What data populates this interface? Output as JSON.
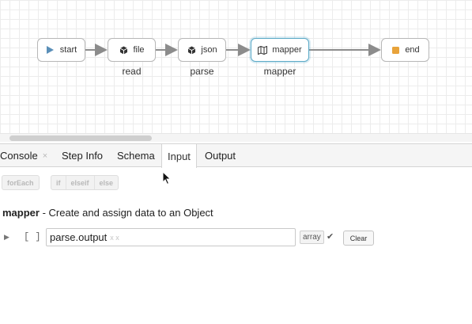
{
  "flow": {
    "nodes": [
      {
        "id": "start",
        "label": "start",
        "icon": "play-icon",
        "sublabel": ""
      },
      {
        "id": "file",
        "label": "file",
        "icon": "cube-icon",
        "sublabel": "read"
      },
      {
        "id": "json",
        "label": "json",
        "icon": "cube-icon",
        "sublabel": "parse"
      },
      {
        "id": "mapper",
        "label": "mapper",
        "icon": "map-icon",
        "sublabel": "mapper",
        "selected": true
      },
      {
        "id": "end",
        "label": "end",
        "icon": "stop-icon",
        "sublabel": ""
      }
    ],
    "colors": {
      "start_icon": "#5a8fb8",
      "end_icon": "#e8a33a",
      "selected_border": "#5aa9c7",
      "edge": "#8c8c8c"
    }
  },
  "tabs": [
    {
      "label": "Console",
      "close": "×"
    },
    {
      "label": "Step Info"
    },
    {
      "label": "Schema"
    },
    {
      "label": "Input",
      "active": true
    },
    {
      "label": "Output"
    }
  ],
  "toolbar": {
    "foreach": "forEach",
    "if": "if",
    "elseif": "elseif",
    "else": "else"
  },
  "mapper": {
    "name": "mapper",
    "description": " - Create and assign data to an Object"
  },
  "row": {
    "expander": "▶",
    "brackets": "[ ]",
    "value": "parse.output",
    "hint": "x x",
    "type": "array",
    "check": "✔",
    "clear_label": "Clear"
  }
}
